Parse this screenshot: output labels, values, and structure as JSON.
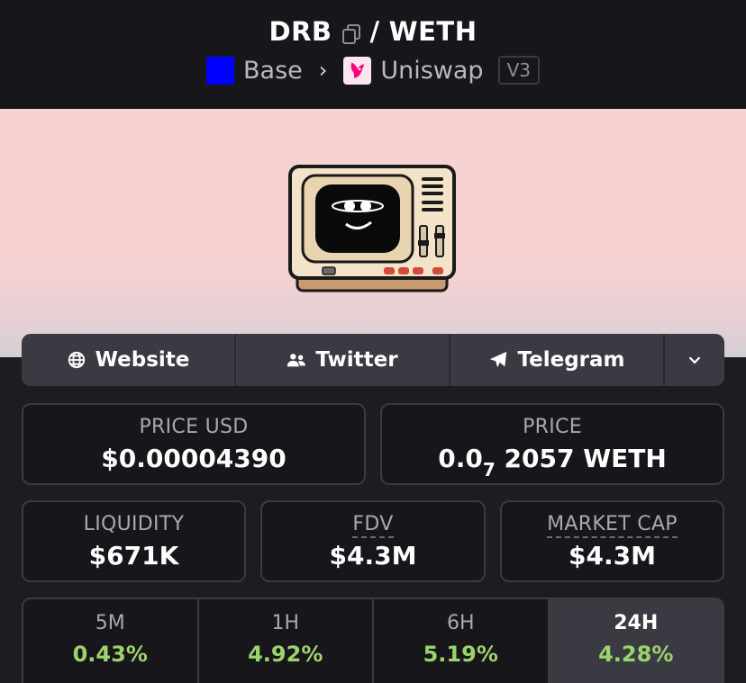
{
  "header": {
    "base_token": "DRB",
    "separator": "/",
    "quote_token": "WETH",
    "chain": "Base",
    "chain_color": "#0000ff",
    "dex": "Uniswap",
    "version": "V3"
  },
  "links": [
    {
      "label": "Website",
      "icon": "globe-icon"
    },
    {
      "label": "Twitter",
      "icon": "users-icon"
    },
    {
      "label": "Telegram",
      "icon": "paper-plane-icon"
    },
    {
      "label": "",
      "icon": "chevron-down-icon"
    }
  ],
  "price_usd": {
    "label": "PRICE USD",
    "value": "$0.00004390"
  },
  "price_native": {
    "label": "PRICE",
    "prefix": "0.0",
    "subscript": "7",
    "digits": "2057",
    "unit": "WETH"
  },
  "liquidity": {
    "label": "LIQUIDITY",
    "value": "$671K"
  },
  "fdv": {
    "label": "FDV",
    "value": "$4.3M"
  },
  "market_cap": {
    "label": "MARKET CAP",
    "value": "$4.3M"
  },
  "timeframes": [
    {
      "label": "5M",
      "change": "0.43%"
    },
    {
      "label": "1H",
      "change": "4.92%"
    },
    {
      "label": "6H",
      "change": "5.19%"
    },
    {
      "label": "24H",
      "change": "4.28%",
      "selected": true
    }
  ],
  "colors": {
    "positive": "#9bd46a",
    "background": "#1c1c21",
    "border": "#3a3a42"
  }
}
